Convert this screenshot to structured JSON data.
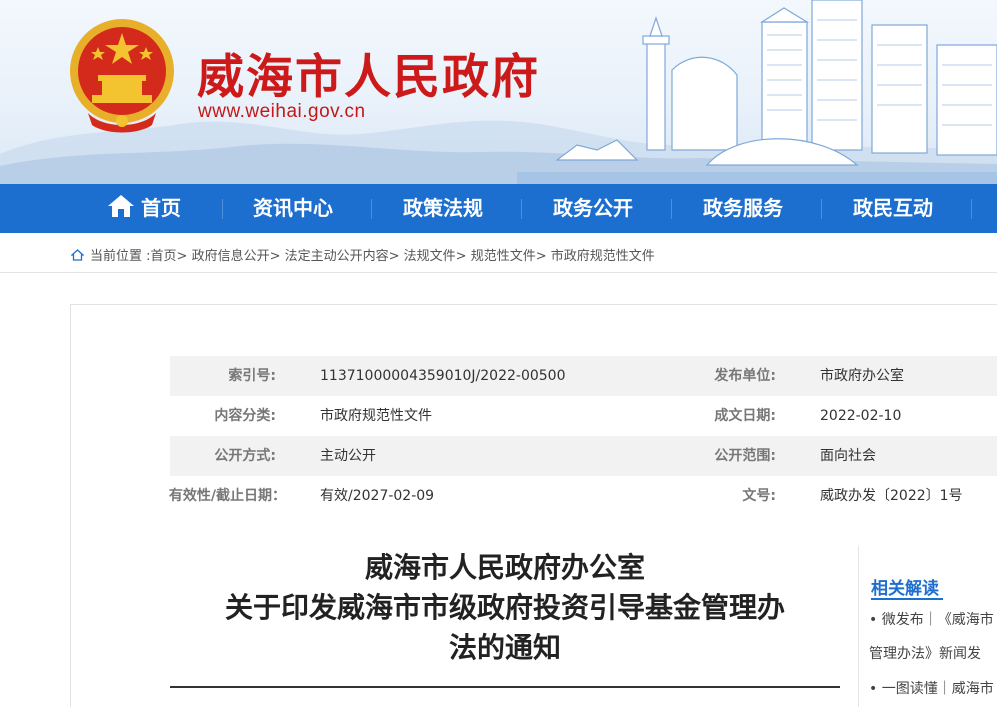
{
  "header": {
    "site_title": "威海市人民政府",
    "site_url": "www.weihai.gov.cn"
  },
  "nav": {
    "items": [
      "首页",
      "资讯中心",
      "政策法规",
      "政务公开",
      "政务服务",
      "政民互动"
    ]
  },
  "breadcrumb": {
    "prefix": "当前位置 :",
    "items": [
      "首页",
      "政府信息公开",
      "法定主动公开内容",
      "法规文件",
      "规范性文件",
      "市政府规范性文件"
    ],
    "separator": "> "
  },
  "info": {
    "rows": [
      {
        "label1": "索引号:",
        "value1": "11371000004359010J/2022-00500",
        "label2": "发布单位:",
        "value2": "市政府办公室"
      },
      {
        "label1": "内容分类:",
        "value1": "市政府规范性文件",
        "label2": "成文日期:",
        "value2": "2022-02-10"
      },
      {
        "label1": "公开方式:",
        "value1": "主动公开",
        "label2": "公开范围:",
        "value2": "面向社会"
      },
      {
        "label1": "有效性/截止日期：",
        "value1": "有效/2027-02-09",
        "label2": "文号:",
        "value2": "威政办发〔2022〕1号"
      }
    ]
  },
  "document": {
    "title_line1": "威海市人民政府办公室",
    "title_line2": "关于印发威海市市级政府投资引导基金管理办",
    "title_line3": "法的通知"
  },
  "sidebar": {
    "heading": "相关解读",
    "items": [
      "• 微发布｜《威海市",
      "管理办法》新闻发",
      "• 一图读懂｜威海市"
    ]
  },
  "colors": {
    "brand_red": "#cc1a1a",
    "nav_blue": "#1d6fcf"
  },
  "icons": {
    "home": "home-icon",
    "location": "home-outline-icon",
    "emblem": "national-emblem"
  }
}
